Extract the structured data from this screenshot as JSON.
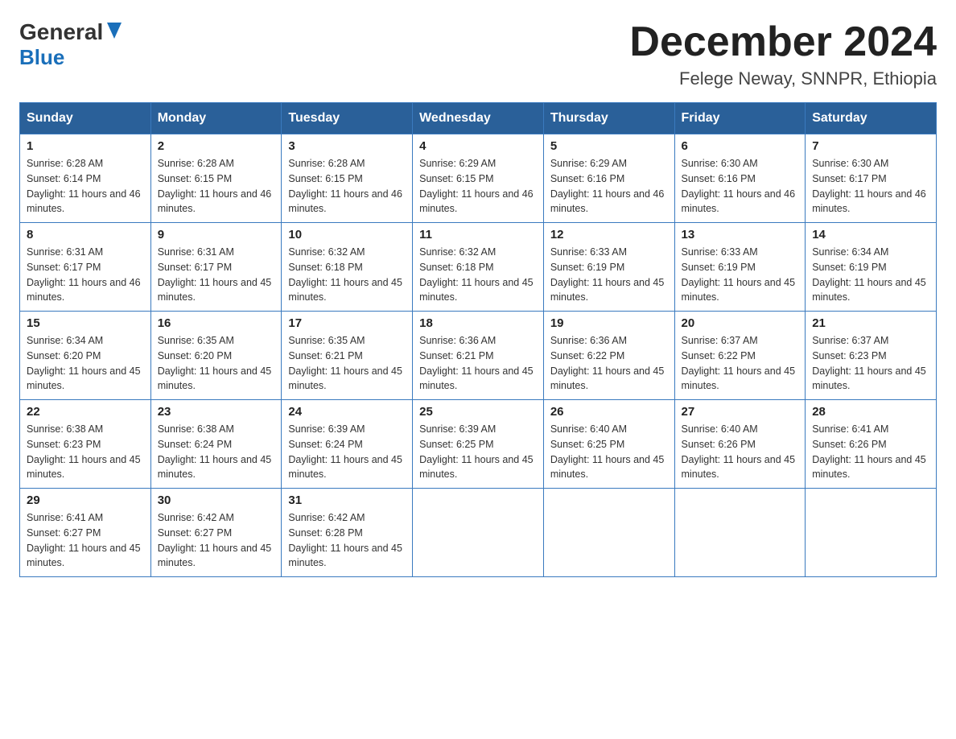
{
  "logo": {
    "general": "General",
    "blue": "Blue"
  },
  "title": {
    "month": "December 2024",
    "location": "Felege Neway, SNNPR, Ethiopia"
  },
  "headers": [
    "Sunday",
    "Monday",
    "Tuesday",
    "Wednesday",
    "Thursday",
    "Friday",
    "Saturday"
  ],
  "weeks": [
    [
      {
        "day": "1",
        "sunrise": "6:28 AM",
        "sunset": "6:14 PM",
        "daylight": "11 hours and 46 minutes."
      },
      {
        "day": "2",
        "sunrise": "6:28 AM",
        "sunset": "6:15 PM",
        "daylight": "11 hours and 46 minutes."
      },
      {
        "day": "3",
        "sunrise": "6:28 AM",
        "sunset": "6:15 PM",
        "daylight": "11 hours and 46 minutes."
      },
      {
        "day": "4",
        "sunrise": "6:29 AM",
        "sunset": "6:15 PM",
        "daylight": "11 hours and 46 minutes."
      },
      {
        "day": "5",
        "sunrise": "6:29 AM",
        "sunset": "6:16 PM",
        "daylight": "11 hours and 46 minutes."
      },
      {
        "day": "6",
        "sunrise": "6:30 AM",
        "sunset": "6:16 PM",
        "daylight": "11 hours and 46 minutes."
      },
      {
        "day": "7",
        "sunrise": "6:30 AM",
        "sunset": "6:17 PM",
        "daylight": "11 hours and 46 minutes."
      }
    ],
    [
      {
        "day": "8",
        "sunrise": "6:31 AM",
        "sunset": "6:17 PM",
        "daylight": "11 hours and 46 minutes."
      },
      {
        "day": "9",
        "sunrise": "6:31 AM",
        "sunset": "6:17 PM",
        "daylight": "11 hours and 45 minutes."
      },
      {
        "day": "10",
        "sunrise": "6:32 AM",
        "sunset": "6:18 PM",
        "daylight": "11 hours and 45 minutes."
      },
      {
        "day": "11",
        "sunrise": "6:32 AM",
        "sunset": "6:18 PM",
        "daylight": "11 hours and 45 minutes."
      },
      {
        "day": "12",
        "sunrise": "6:33 AM",
        "sunset": "6:19 PM",
        "daylight": "11 hours and 45 minutes."
      },
      {
        "day": "13",
        "sunrise": "6:33 AM",
        "sunset": "6:19 PM",
        "daylight": "11 hours and 45 minutes."
      },
      {
        "day": "14",
        "sunrise": "6:34 AM",
        "sunset": "6:19 PM",
        "daylight": "11 hours and 45 minutes."
      }
    ],
    [
      {
        "day": "15",
        "sunrise": "6:34 AM",
        "sunset": "6:20 PM",
        "daylight": "11 hours and 45 minutes."
      },
      {
        "day": "16",
        "sunrise": "6:35 AM",
        "sunset": "6:20 PM",
        "daylight": "11 hours and 45 minutes."
      },
      {
        "day": "17",
        "sunrise": "6:35 AM",
        "sunset": "6:21 PM",
        "daylight": "11 hours and 45 minutes."
      },
      {
        "day": "18",
        "sunrise": "6:36 AM",
        "sunset": "6:21 PM",
        "daylight": "11 hours and 45 minutes."
      },
      {
        "day": "19",
        "sunrise": "6:36 AM",
        "sunset": "6:22 PM",
        "daylight": "11 hours and 45 minutes."
      },
      {
        "day": "20",
        "sunrise": "6:37 AM",
        "sunset": "6:22 PM",
        "daylight": "11 hours and 45 minutes."
      },
      {
        "day": "21",
        "sunrise": "6:37 AM",
        "sunset": "6:23 PM",
        "daylight": "11 hours and 45 minutes."
      }
    ],
    [
      {
        "day": "22",
        "sunrise": "6:38 AM",
        "sunset": "6:23 PM",
        "daylight": "11 hours and 45 minutes."
      },
      {
        "day": "23",
        "sunrise": "6:38 AM",
        "sunset": "6:24 PM",
        "daylight": "11 hours and 45 minutes."
      },
      {
        "day": "24",
        "sunrise": "6:39 AM",
        "sunset": "6:24 PM",
        "daylight": "11 hours and 45 minutes."
      },
      {
        "day": "25",
        "sunrise": "6:39 AM",
        "sunset": "6:25 PM",
        "daylight": "11 hours and 45 minutes."
      },
      {
        "day": "26",
        "sunrise": "6:40 AM",
        "sunset": "6:25 PM",
        "daylight": "11 hours and 45 minutes."
      },
      {
        "day": "27",
        "sunrise": "6:40 AM",
        "sunset": "6:26 PM",
        "daylight": "11 hours and 45 minutes."
      },
      {
        "day": "28",
        "sunrise": "6:41 AM",
        "sunset": "6:26 PM",
        "daylight": "11 hours and 45 minutes."
      }
    ],
    [
      {
        "day": "29",
        "sunrise": "6:41 AM",
        "sunset": "6:27 PM",
        "daylight": "11 hours and 45 minutes."
      },
      {
        "day": "30",
        "sunrise": "6:42 AM",
        "sunset": "6:27 PM",
        "daylight": "11 hours and 45 minutes."
      },
      {
        "day": "31",
        "sunrise": "6:42 AM",
        "sunset": "6:28 PM",
        "daylight": "11 hours and 45 minutes."
      },
      null,
      null,
      null,
      null
    ]
  ]
}
